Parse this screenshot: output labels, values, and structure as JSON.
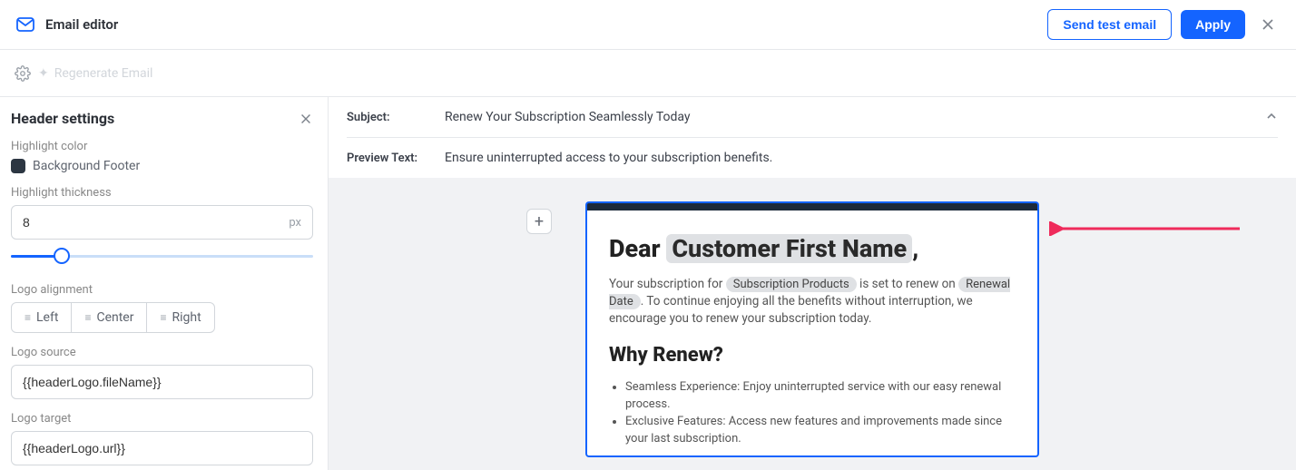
{
  "header": {
    "title": "Email editor",
    "send_test_label": "Send test email",
    "apply_label": "Apply"
  },
  "subheader": {
    "regenerate_label": "Regenerate Email"
  },
  "sidebar": {
    "title": "Header settings",
    "highlight_color_label": "Highlight color",
    "bg_footer_label": "Background Footer",
    "highlight_thickness_label": "Highlight thickness",
    "thickness_value": "8",
    "thickness_unit": "px",
    "logo_alignment_label": "Logo alignment",
    "align_left": "Left",
    "align_center": "Center",
    "align_right": "Right",
    "logo_source_label": "Logo source",
    "logo_source_value": "{{headerLogo.fileName}}",
    "logo_target_label": "Logo target",
    "logo_target_value": "{{headerLogo.url}}"
  },
  "meta": {
    "subject_label": "Subject:",
    "subject_value": "Renew Your Subscription Seamlessly Today",
    "preview_label": "Preview Text:",
    "preview_value": "Ensure uninterrupted access to your subscription benefits."
  },
  "email": {
    "dear": "Dear ",
    "customer_name_tag": "Customer First Name",
    "comma": ",",
    "p1_a": "Your subscription for ",
    "products_tag": "Subscription Products",
    "p1_b": " is set to renew on ",
    "date_tag": "Renewal Date",
    "p1_c": ". To continue enjoying all the benefits without interruption, we encourage you to renew your subscription today.",
    "h2": "Why Renew?",
    "bullet1": "Seamless Experience: Enjoy uninterrupted service with our easy renewal process.",
    "bullet2": "Exclusive Features: Access new features and improvements made since your last subscription."
  }
}
